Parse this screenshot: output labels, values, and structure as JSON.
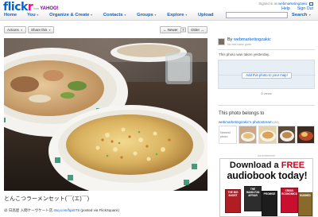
{
  "brand": {
    "name_part1": "flick",
    "name_part2": "r",
    "from": "from",
    "yahoo": "YAHOO!",
    "color_blue": "#0063dc",
    "color_pink": "#ff0084"
  },
  "account": {
    "signed_in_prefix": "Signed in as",
    "user": "webmarketingzakic",
    "mail_icon": "mail-icon",
    "links": [
      "Help",
      "Sign Out"
    ]
  },
  "nav": {
    "items": [
      "Home",
      "You",
      "Organize & Create",
      "Contacts",
      "Groups",
      "Explore",
      "Upload"
    ],
    "search_button": "Search"
  },
  "actions": {
    "actions_label": "Actions",
    "share_label": "Share this",
    "newer_label": "← Newer",
    "older_label": "Older →"
  },
  "photo": {
    "title": "とんこつラーメンセット(￣(エ)￣)",
    "subtitle_prefix": "@ 日高屋 入間ケーヴケート店",
    "subtitle_link": "4sq.com/fqaST6",
    "subtitle_suffix": "(posted via FlickSquare)"
  },
  "sidebar": {
    "by_prefix": "By",
    "owner": "webmarketingzakic",
    "owner_sub": "No real name given",
    "taken_text": "This photo was taken yesterday.",
    "map_button": "Add this photo to your map!",
    "views": "0 views",
    "belongs_title": "This photo belongs to",
    "stream_link": "webmarketingzakic's photostream",
    "stream_count": "(20)",
    "newest_label": "Newest photo"
  },
  "ad": {
    "label": "Advertisement",
    "line1_a": "Download a",
    "line1_b": "FREE",
    "line2": "audiobook today!",
    "book_titles": [
      "THE BIG SHORT",
      "THE HAMILTON AFFAIR",
      "PROMISE",
      "CRISIS ECONOMICS",
      "BUSHED"
    ]
  }
}
